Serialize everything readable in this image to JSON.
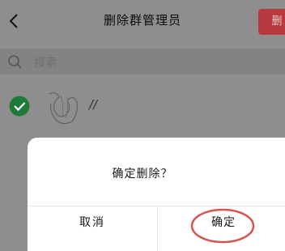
{
  "header": {
    "title": "删除群管理员",
    "action_label": "删"
  },
  "search": {
    "placeholder": "搜索"
  },
  "members": [
    {
      "name": "//",
      "selected": true
    }
  ],
  "dialog": {
    "message": "确定删除？",
    "cancel_label": "取消",
    "confirm_label": "确定"
  },
  "colors": {
    "accent_red": "#b83a3f",
    "check_green": "#1f7a3a",
    "annotation_red": "#d9534f"
  }
}
